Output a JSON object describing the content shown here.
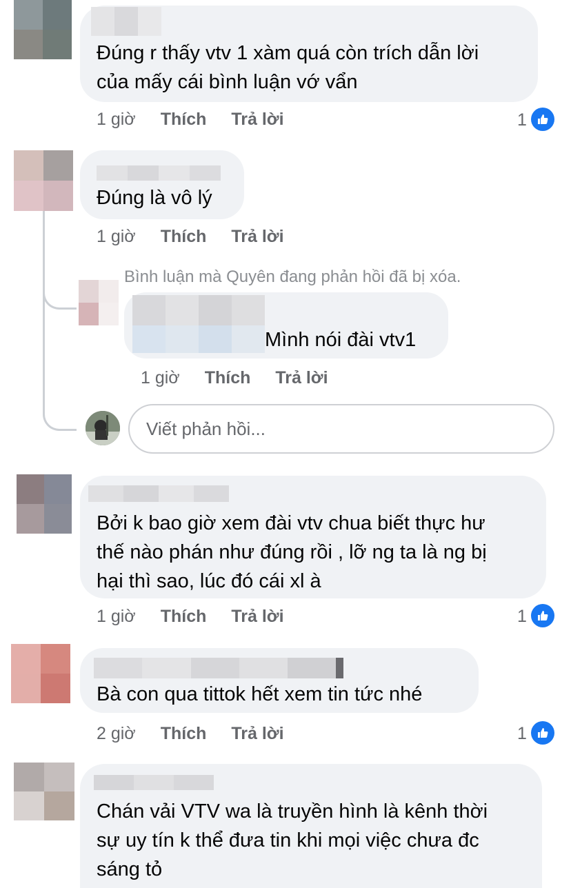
{
  "comments": [
    {
      "text_lines": [
        "Đúng r thấy vtv 1 xàm quá còn trích dẫn lời",
        "của mấy cái bình luận vớ vẩn"
      ],
      "time": "1 giờ",
      "like_label": "Thích",
      "reply_label": "Trả lời",
      "reactions": "1"
    },
    {
      "text_lines": [
        "Đúng là vô lý"
      ],
      "time": "1 giờ",
      "like_label": "Thích",
      "reply_label": "Trả lời"
    },
    {
      "text_lines": [
        "Bởi k bao giờ xem đài vtv chua biết thực hư",
        "thế nào phán như đúng rồi , lỡ ng ta là ng bị",
        "hại thì sao, lúc đó cái xl à"
      ],
      "time": "1 giờ",
      "like_label": "Thích",
      "reply_label": "Trả lời",
      "reactions": "1"
    },
    {
      "text_lines": [
        "Bà con qua tittok hết xem tin tức nhé"
      ],
      "time": "2 giờ",
      "like_label": "Thích",
      "reply_label": "Trả lời",
      "reactions": "1"
    },
    {
      "text_lines": [
        "Chán vải VTV wa là truyền hình là kênh thời",
        "sự uy tín k thể đưa tin khi mọi việc chưa đc",
        "sáng tỏ"
      ]
    }
  ],
  "reply": {
    "deleted_notice": "Bình luận mà Quyên đang phản hồi đã bị xóa.",
    "text": "Mình nói đài vtv1",
    "time": "1 giờ",
    "like_label": "Thích",
    "reply_label": "Trả lời"
  },
  "reply_input": {
    "placeholder": "Viết phản hồi..."
  },
  "colors": {
    "like_blue": "#1877f2",
    "bubble": "#f0f2f5",
    "meta_text": "#65676b"
  },
  "icons": {
    "like": "thumbs-up-icon"
  }
}
